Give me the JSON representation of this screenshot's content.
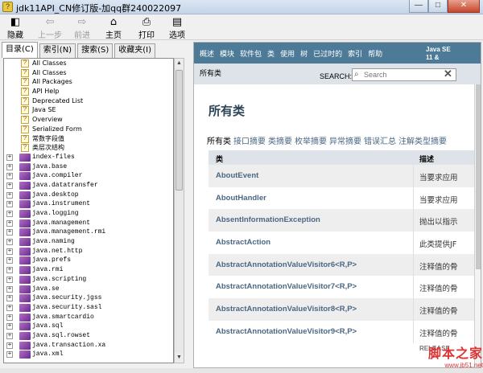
{
  "window": {
    "title": "jdk11API_CN修订版-加qq群240022097",
    "app_icon": "help-book-icon",
    "buttons": [
      "minimize",
      "maximize",
      "close"
    ]
  },
  "toolbar": {
    "items": [
      {
        "label": "隐藏",
        "icon": "hide-icon",
        "enabled": true
      },
      {
        "label": "上一步",
        "icon": "back-arrow-icon",
        "enabled": false
      },
      {
        "label": "前进",
        "icon": "forward-arrow-icon",
        "enabled": false
      },
      {
        "label": "主页",
        "icon": "home-icon",
        "enabled": true
      },
      {
        "label": "打印",
        "icon": "print-icon",
        "enabled": true
      },
      {
        "label": "选项",
        "icon": "options-icon",
        "enabled": true
      }
    ]
  },
  "left_tabs": [
    {
      "label": "目录(C)",
      "active": true
    },
    {
      "label": "索引(N)",
      "active": false
    },
    {
      "label": "搜索(S)",
      "active": false
    },
    {
      "label": "收藏夹(I)",
      "active": false
    }
  ],
  "tree": {
    "docs": [
      "All Classes",
      "All Classes",
      "All Packages",
      "API Help",
      "Deprecated List",
      "Java SE",
      "Overview",
      "Serialized Form",
      "常数字段值",
      "类层次结构"
    ],
    "modules": [
      "index-files",
      "java.base",
      "java.compiler",
      "java.datatransfer",
      "java.desktop",
      "java.instrument",
      "java.logging",
      "java.management",
      "java.management.rmi",
      "java.naming",
      "java.net.http",
      "java.prefs",
      "java.rmi",
      "java.scripting",
      "java.se",
      "java.security.jgss",
      "java.security.sasl",
      "java.smartcardio",
      "java.sql",
      "java.sql.rowset",
      "java.transaction.xa",
      "java.xml"
    ]
  },
  "content": {
    "nav_links": [
      "概述",
      "模块",
      "软件包",
      "类",
      "使用",
      "树",
      "已过时的",
      "索引",
      "帮助"
    ],
    "nav_version": [
      "Java SE",
      "11 &"
    ],
    "subnav_all": "所有类",
    "search_label": "SEARCH:",
    "search_placeholder": "Search",
    "heading": "所有类",
    "filters": [
      "所有类",
      "接口摘要",
      "类摘要",
      "枚举摘要",
      "异常摘要",
      "错误汇总",
      "注解类型摘要"
    ],
    "table_headers": [
      "类",
      "描述"
    ],
    "rows": [
      {
        "name": "AboutEvent",
        "desc": "当要求应用"
      },
      {
        "name": "AboutHandler",
        "desc": "当要求应用"
      },
      {
        "name": "AbsentInformationException",
        "desc": "抛出以指示"
      },
      {
        "name": "AbstractAction",
        "desc": "此类提供JF"
      },
      {
        "name": "AbstractAnnotationValueVisitor6<R,P>",
        "desc": "注释值的骨"
      },
      {
        "name": "AbstractAnnotationValueVisitor7<R,P>",
        "desc": "注释值的骨"
      },
      {
        "name": "AbstractAnnotationValueVisitor8<R,P>",
        "desc": "注释值的骨"
      },
      {
        "name": "AbstractAnnotationValueVisitor9<R,P>",
        "desc": "注释值的骨"
      }
    ],
    "release_text": "RELEASE"
  },
  "watermark": {
    "line1": "脚本之家",
    "line2": "www.jb51.net"
  },
  "colors": {
    "nav_bg": "#4d7a97",
    "subnav_bg": "#dee3e9",
    "link": "#4a6782",
    "row_alt": "#eeeeef"
  }
}
